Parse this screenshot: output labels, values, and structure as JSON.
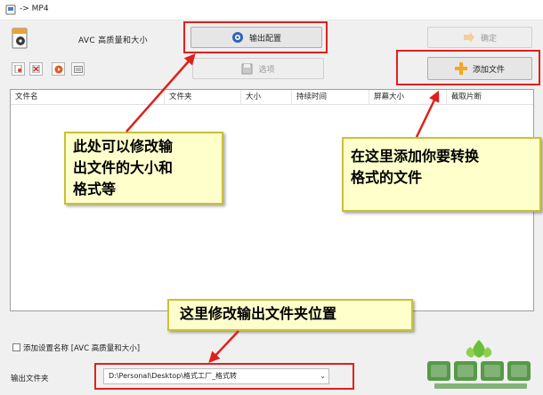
{
  "window": {
    "title": "-> MP4"
  },
  "profile": {
    "label": "AVC 高质量和大小"
  },
  "buttons": {
    "output_config": "输出配置",
    "options": "选项",
    "confirm": "确定",
    "add_file": "添加文件"
  },
  "table": {
    "columns": [
      "文件名",
      "文件夹",
      "大小",
      "持续时间",
      "屏幕大小",
      "截取片断"
    ]
  },
  "annotations": {
    "left": [
      "此处可以修改输",
      "出文件的大小和",
      "格式等"
    ],
    "right": [
      "在这里添加你要转换",
      "格式的文件"
    ],
    "bottom": [
      "这里修改输出文件夹位置"
    ]
  },
  "footer": {
    "checkbox_label": "添加设置名称 [AVC 高质量和大小]",
    "output_folder_label": "输出文件夹",
    "output_folder_value": "D:\\Personal\\Desktop\\格式工厂_格式转"
  },
  "watermark": {
    "text": "雨林木风",
    "url": "www.YLMFU.com"
  },
  "colors": {
    "highlight": "#e0201b",
    "note_bg": "#ffffcc",
    "accent_orange": "#f5a623"
  }
}
